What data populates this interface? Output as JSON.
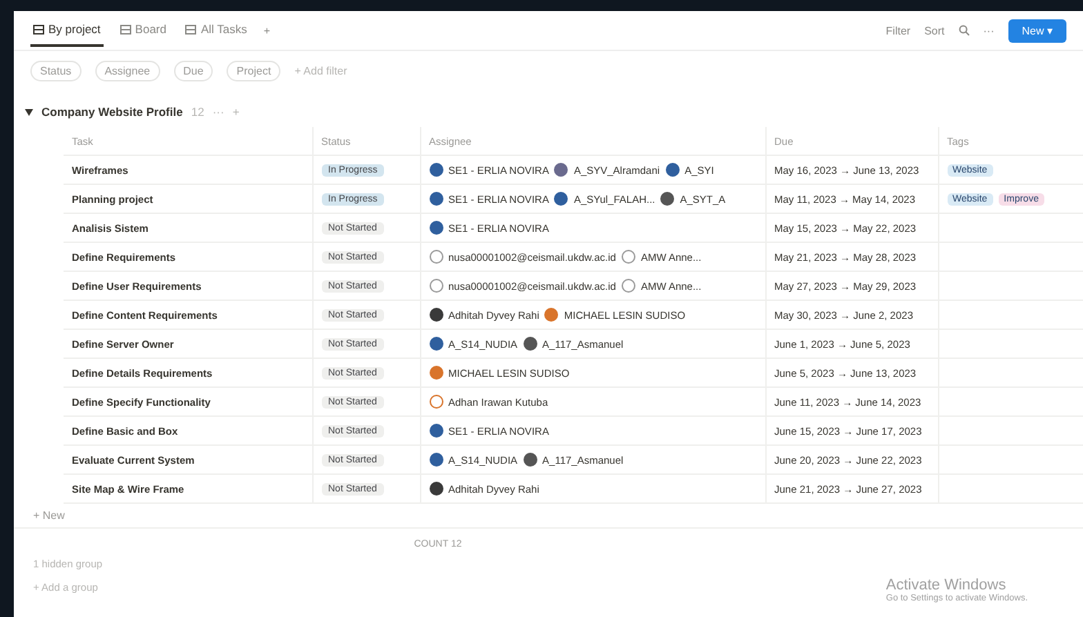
{
  "views": [
    {
      "label": "By project",
      "selected": true
    },
    {
      "label": "Board",
      "selected": false
    },
    {
      "label": "All Tasks",
      "selected": false
    }
  ],
  "more_views": "+",
  "toolbar": {
    "filter": "Filter",
    "sort": "Sort",
    "more": "···",
    "new": "New",
    "new_caret": "▾"
  },
  "filters": [
    "Status",
    "Assignee",
    "Due",
    "Project"
  ],
  "add_filter": "+ Add filter",
  "group": {
    "title": "Company Website Profile",
    "count": "12",
    "more": "···",
    "add": "+",
    "expanded": true
  },
  "columns": [
    "Task",
    "Status",
    "Assignee",
    "Due",
    "Tags"
  ],
  "rows": [
    {
      "task": "Wireframes",
      "status": {
        "label": "In Progress",
        "color": "#d3e5ef"
      },
      "assignees": [
        {
          "name": "SE1 - ERLIA NOVIRA",
          "kind": "avatar",
          "color": "#2f5f9e"
        },
        {
          "name": "A_SYV_Alramdani",
          "kind": "avatar",
          "color": "#6a6a8e"
        },
        {
          "name": "A_SYI",
          "kind": "avatar",
          "color": "#2f5f9e"
        }
      ],
      "due": "May 16, 2023 → June 13, 2023",
      "tags": [
        {
          "label": "Website",
          "color": "#d9eaf5"
        }
      ]
    },
    {
      "task": "Planning project",
      "status": {
        "label": "In Progress",
        "color": "#d3e5ef"
      },
      "assignees": [
        {
          "name": "SE1 - ERLIA NOVIRA",
          "kind": "avatar",
          "color": "#2f5f9e"
        },
        {
          "name": "A_SYul_FALAH...",
          "kind": "avatar",
          "color": "#2f5f9e"
        },
        {
          "name": "A_SYT_A",
          "kind": "avatar",
          "color": "#555555"
        }
      ],
      "due": "May 11, 2023 → May 14, 2023",
      "tags": [
        {
          "label": "Website",
          "color": "#d9eaf5"
        },
        {
          "label": "Improve",
          "color": "#f7dde8"
        }
      ]
    },
    {
      "task": "Analisis Sistem",
      "status": {
        "label": "Not Started",
        "color": "#efefed"
      },
      "assignees": [
        {
          "name": "SE1 - ERLIA NOVIRA",
          "kind": "avatar",
          "color": "#2f5f9e"
        }
      ],
      "due": "May 15, 2023 → May 22, 2023",
      "tags": []
    },
    {
      "task": "Define Requirements",
      "status": {
        "label": "Not Started",
        "color": "#efefed"
      },
      "assignees": [
        {
          "name": "nusa00001002@ceismail.ukdw.ac.id",
          "kind": "email",
          "color": "#9a9a9a"
        },
        {
          "name": "AMW Anne...",
          "kind": "email",
          "color": "#9a9a9a"
        }
      ],
      "due": "May 21, 2023 → May 28, 2023",
      "tags": []
    },
    {
      "task": "Define User Requirements",
      "status": {
        "label": "Not Started",
        "color": "#efefed"
      },
      "assignees": [
        {
          "name": "nusa00001002@ceismail.ukdw.ac.id",
          "kind": "email",
          "color": "#9a9a9a"
        },
        {
          "name": "AMW Anne...",
          "kind": "email",
          "color": "#9a9a9a"
        }
      ],
      "due": "May 27, 2023 → May 29, 2023",
      "tags": []
    },
    {
      "task": "Define Content Requirements",
      "status": {
        "label": "Not Started",
        "color": "#efefed"
      },
      "assignees": [
        {
          "name": "Adhitah Dyvey Rahi",
          "kind": "avatar",
          "color": "#3a3a3a"
        },
        {
          "name": "MICHAEL LESIN SUDISO",
          "kind": "avatar",
          "color": "#d9742b"
        }
      ],
      "due": "May 30, 2023 → June 2, 2023",
      "tags": []
    },
    {
      "task": "Define Server Owner",
      "status": {
        "label": "Not Started",
        "color": "#efefed"
      },
      "assignees": [
        {
          "name": "A_S14_NUDIA",
          "kind": "avatar",
          "color": "#2f5f9e"
        },
        {
          "name": "A_117_Asmanuel",
          "kind": "avatar",
          "color": "#555555"
        }
      ],
      "due": "June 1, 2023 → June 5, 2023",
      "tags": []
    },
    {
      "task": "Define Details Requirements",
      "status": {
        "label": "Not Started",
        "color": "#efefed"
      },
      "assignees": [
        {
          "name": "MICHAEL LESIN SUDISO",
          "kind": "avatar",
          "color": "#d9742b"
        }
      ],
      "due": "June 5, 2023 → June 13, 2023",
      "tags": []
    },
    {
      "task": "Define Specify Functionality",
      "status": {
        "label": "Not Started",
        "color": "#efefed"
      },
      "assignees": [
        {
          "name": "Adhan Irawan Kutuba",
          "kind": "email",
          "color": "#d9742b"
        }
      ],
      "due": "June 11, 2023 → June 14, 2023",
      "tags": []
    },
    {
      "task": "Define Basic and Box",
      "status": {
        "label": "Not Started",
        "color": "#efefed"
      },
      "assignees": [
        {
          "name": "SE1 - ERLIA NOVIRA",
          "kind": "avatar",
          "color": "#2f5f9e"
        }
      ],
      "due": "June 15, 2023 → June 17, 2023",
      "tags": []
    },
    {
      "task": "Evaluate Current System",
      "status": {
        "label": "Not Started",
        "color": "#efefed"
      },
      "assignees": [
        {
          "name": "A_S14_NUDIA",
          "kind": "avatar",
          "color": "#2f5f9e"
        },
        {
          "name": "A_117_Asmanuel",
          "kind": "avatar",
          "color": "#555555"
        }
      ],
      "due": "June 20, 2023 → June 22, 2023",
      "tags": []
    },
    {
      "task": "Site Map & Wire Frame",
      "status": {
        "label": "Not Started",
        "color": "#efefed"
      },
      "assignees": [
        {
          "name": "Adhitah Dyvey Rahi",
          "kind": "avatar",
          "color": "#3a3a3a"
        }
      ],
      "due": "June 21, 2023 → June 27, 2023",
      "tags": []
    }
  ],
  "new_row": "+ New",
  "count": "COUNT 12",
  "hidden_group": "1 hidden group",
  "add_group": "+ Add a group",
  "activation": {
    "title": "Activate Windows",
    "subtitle": "Go to Settings to activate Windows."
  }
}
